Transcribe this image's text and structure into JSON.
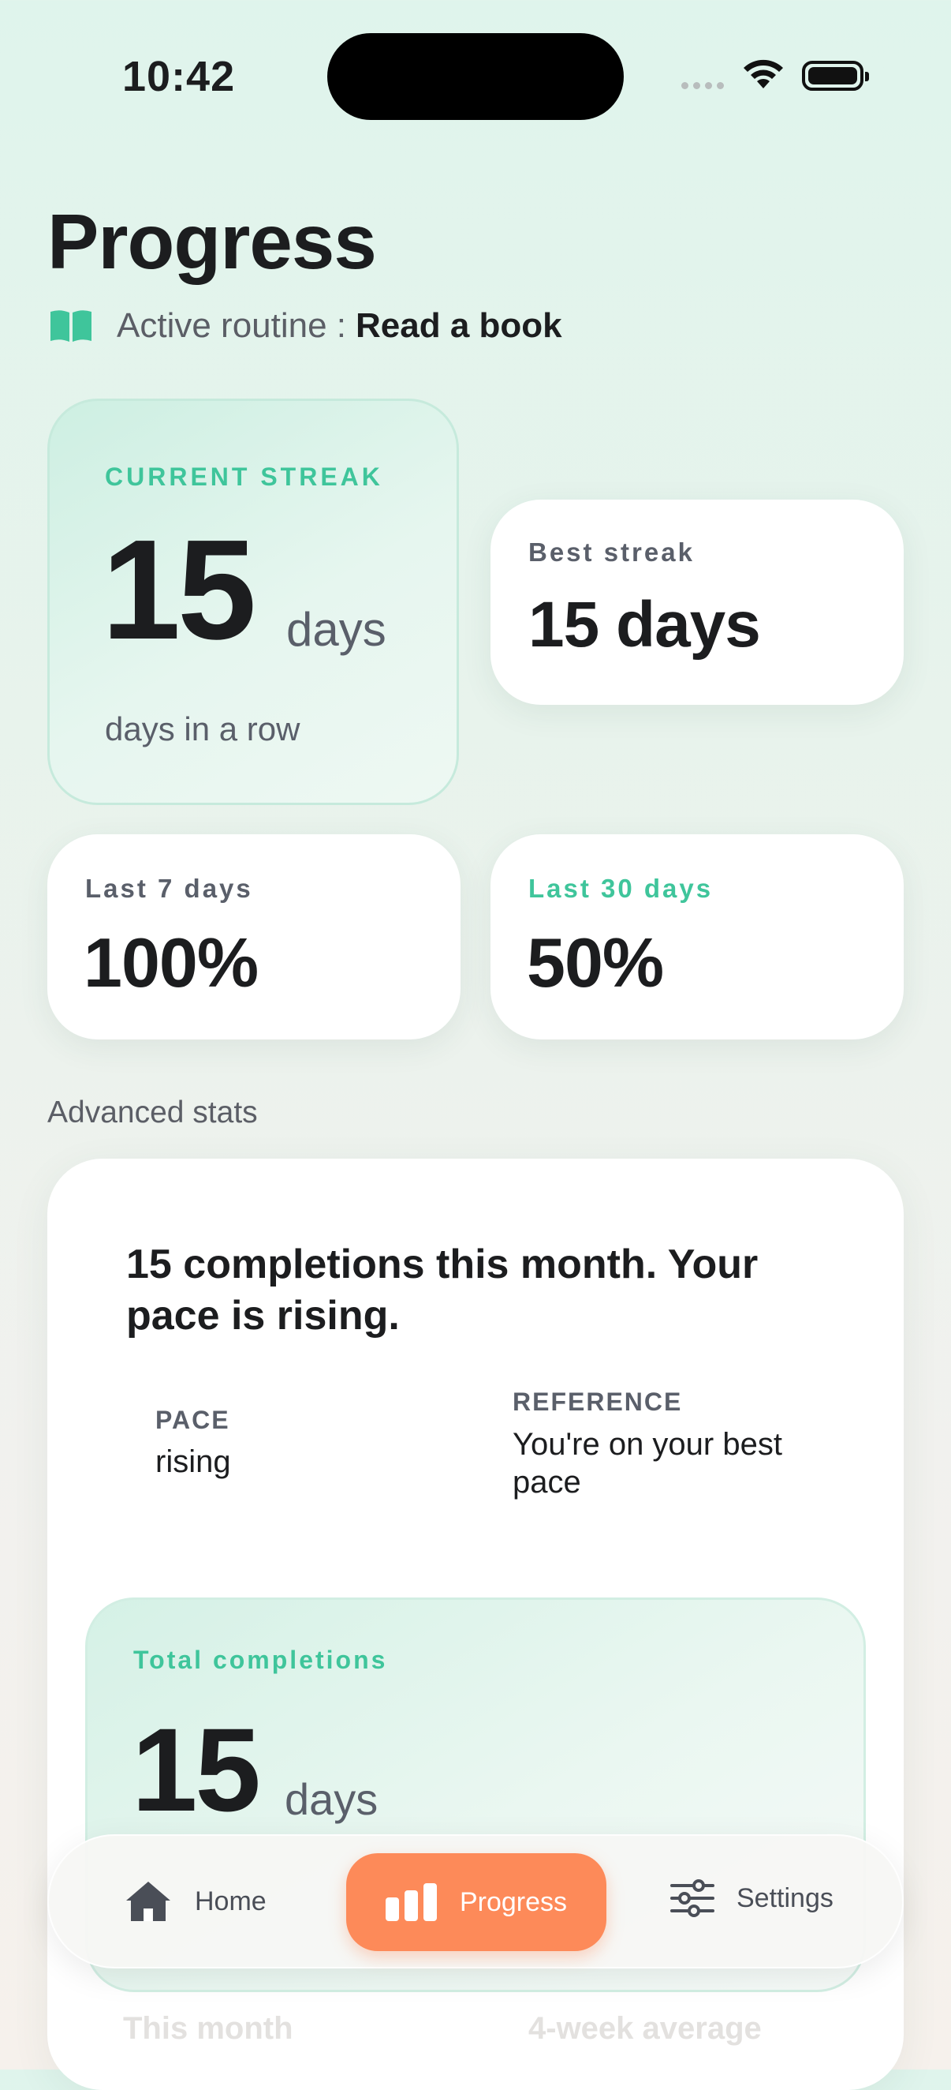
{
  "status_bar": {
    "time": "10:42"
  },
  "header": {
    "title": "Progress",
    "routine_prefix": "Active routine :",
    "routine_name": "Read a book"
  },
  "current_streak": {
    "label": "CURRENT STREAK",
    "value": "15",
    "unit": "days",
    "subtitle": "days in a row"
  },
  "best_streak": {
    "label": "Best streak",
    "value": "15 days"
  },
  "last_7": {
    "label": "Last 7 days",
    "value": "100%"
  },
  "last_30": {
    "label": "Last 30 days",
    "value": "50%"
  },
  "advanced": {
    "section_title": "Advanced stats",
    "headline": "15 completions this month. Your pace is rising.",
    "pace_label": "PACE",
    "pace_value": "rising",
    "reference_label": "REFERENCE",
    "reference_value": "You're on your best pace",
    "total_label": "Total completions",
    "total_value": "15",
    "total_unit": "days",
    "hidden_label_1": "This month",
    "hidden_label_2": "4-week average"
  },
  "tabbar": {
    "home": "Home",
    "progress": "Progress",
    "settings": "Settings"
  },
  "colors": {
    "accent_teal": "#3fc59b",
    "accent_orange": "#fd8a59"
  }
}
